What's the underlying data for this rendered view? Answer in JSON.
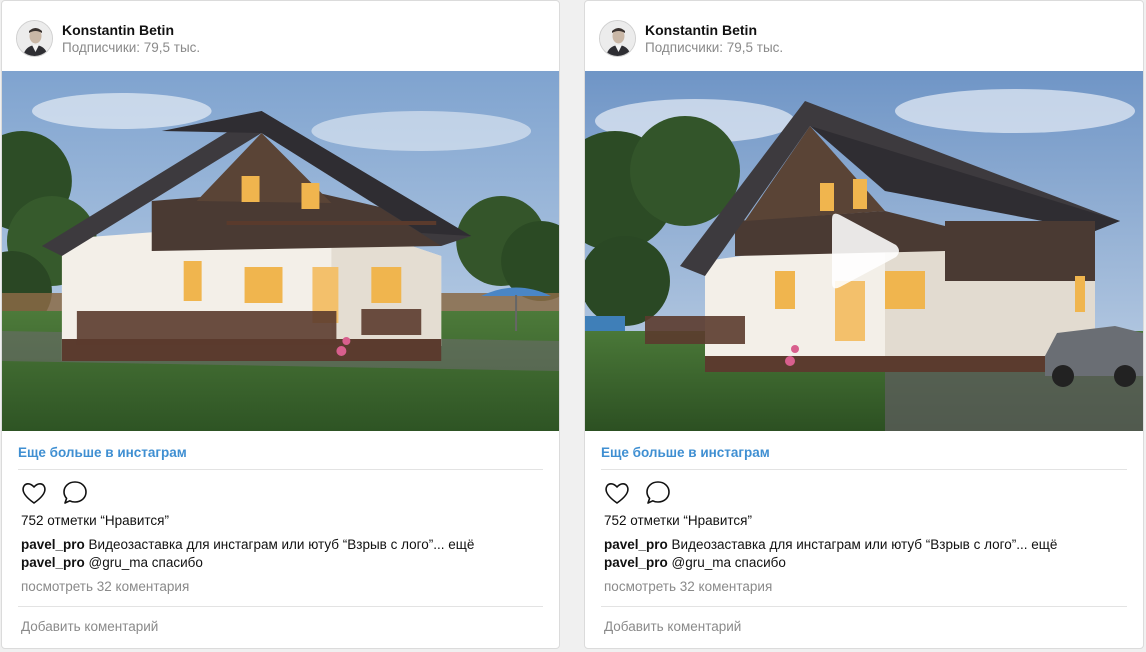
{
  "posts": [
    {
      "author": {
        "name": "Konstantin Betin",
        "followers": "Подписчики: 79,5 тыс."
      },
      "media": {
        "kind": "photo"
      },
      "more_link": "Еще больше в инстаграм",
      "likes": "752 отметки “Нравится”",
      "comments": [
        {
          "user": "pavel_pro",
          "text": " Видеозаставка для инстаграм или ютуб “Взрыв с лого”... ещё"
        },
        {
          "user": "pavel_pro",
          "text": " @gru_ma спасибо"
        }
      ],
      "view_all": "посмотреть 32 коментария",
      "add_comment": "Добавить коментарий"
    },
    {
      "author": {
        "name": "Konstantin Betin",
        "followers": "Подписчики: 79,5 тыс."
      },
      "media": {
        "kind": "video"
      },
      "more_link": "Еще больше в инстаграм",
      "likes": "752 отметки “Нравится”",
      "comments": [
        {
          "user": "pavel_pro",
          "text": " Видеозаставка для инстаграм или ютуб “Взрыв с лого”... ещё"
        },
        {
          "user": "pavel_pro",
          "text": " @gru_ma спасибо"
        }
      ],
      "view_all": "посмотреть 32 коментария",
      "add_comment": "Добавить коментарий"
    }
  ],
  "colors": {
    "link": "#3f8fd2",
    "muted": "#8a8a8a",
    "border": "#dbdbdb"
  },
  "icons": [
    "heart-icon",
    "comment-icon",
    "play-icon"
  ]
}
